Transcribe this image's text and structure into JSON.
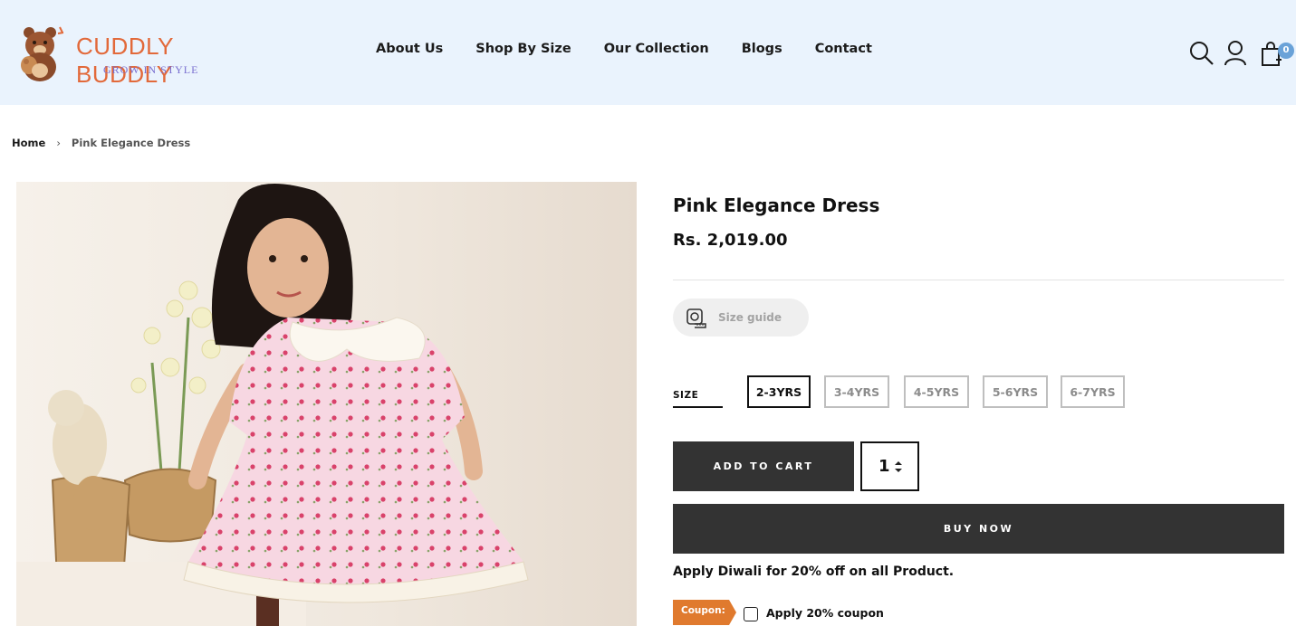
{
  "brand": {
    "name": "CUDDLY BUDDLY",
    "tagline": "GROW IN STYLE"
  },
  "nav": {
    "items": [
      "About Us",
      "Shop By Size",
      "Our Collection",
      "Blogs",
      "Contact"
    ]
  },
  "header_icons": {
    "cart_count": "0",
    "icons": [
      "search-icon",
      "account-icon",
      "cart-icon"
    ]
  },
  "breadcrumb": {
    "home": "Home",
    "current": "Pink Elegance Dress"
  },
  "product": {
    "title": "Pink Elegance Dress",
    "price": "Rs. 2,019.00",
    "size_guide_label": "Size guide",
    "size_label": "SIZE",
    "sizes": [
      "2-3YRS",
      "3-4YRS",
      "4-5YRS",
      "5-6YRS",
      "6-7YRS"
    ],
    "selected_size": "2-3YRS",
    "add_to_cart_label": "ADD TO CART",
    "quantity": "1",
    "buy_now_label": "BUY NOW",
    "promo_text": "Apply Diwali for 20% off on all Product.",
    "coupon_tag": "Coupon:",
    "coupon_checkbox_label": "Apply 20% coupon"
  },
  "colors": {
    "header_bg": "#eaf3fd",
    "logo_orange": "#e2693a",
    "logo_purple": "#7a6fd0",
    "button_dark": "#333333",
    "coupon_orange": "#e07a2e",
    "badge_blue": "#6aa2d8"
  }
}
